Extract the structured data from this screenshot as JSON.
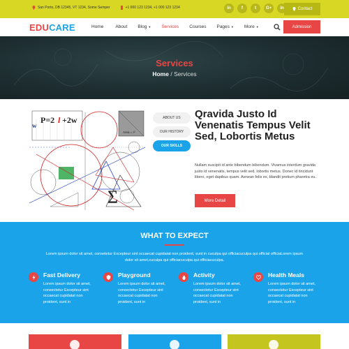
{
  "topbar": {
    "address": "San Porto, DB 12345, VT 1234, Some Semper",
    "phones": "+1 000 123 1234, +1 000 123 1234",
    "socials": [
      "in",
      "f",
      "t",
      "G+",
      "in"
    ],
    "contact_label": "Contact"
  },
  "nav": {
    "logo_edu": "EDU",
    "logo_care": "CARE",
    "items": [
      {
        "label": "Home",
        "dropdown": false
      },
      {
        "label": "About",
        "dropdown": false
      },
      {
        "label": "Blog",
        "dropdown": true
      },
      {
        "label": "Services",
        "dropdown": false
      },
      {
        "label": "Courses",
        "dropdown": false
      },
      {
        "label": "Pages",
        "dropdown": true
      },
      {
        "label": "More",
        "dropdown": true
      }
    ],
    "admission_label": "Admission"
  },
  "hero": {
    "title": "Services",
    "breadcrumb_home": "Home",
    "breadcrumb_sep": " / ",
    "breadcrumb_current": "Services"
  },
  "content": {
    "tabs": [
      "ABOUT US",
      "OUR HISTORY",
      "OUR SKILLS"
    ],
    "heading": "Qravida Justo Id Venenatis Tempus Velit Sed, Lobortis Metus",
    "text": "Nullam suscipit id ante bibendum bibendum. Vivamus interdum gravida justo id venenatis, tempus velit sed, lobortis metus. Donec id tincidunt libero, eget dapibus quam. Aenean felis ex, blandit pretium pharetra eu.",
    "button_label": "More Detail",
    "formula_1": "P=2",
    "formula_l": "l",
    "formula_2": "+2w",
    "formula_w": "w",
    "formula_sigma": "Σ",
    "formula_area": "Area = r²"
  },
  "expect": {
    "title": "WHAT TO EXPECT",
    "description": "Lorem ipsum dolor sit amet, consetetur Excepteur sint occaecat cupidatat non proident, sunt in cuculpa qui officiacuculpa qui officiaI officiaLorem ipsum dolor sit amet,cuculpa qui officiacuculpa qui officiacuculpa.",
    "features": [
      {
        "title": "Fast Delivery",
        "text": "Lorem ipsum dolor sit amet, consectetur Excepteur sint occaecat cupidatat non proident, sunt in",
        "icon": "bolt-icon"
      },
      {
        "title": "Playground",
        "text": "Lorem ipsum dolor sit amet, consectetur Excepteur sint occaecat cupidatat non proident, sunt in",
        "icon": "shield-icon"
      },
      {
        "title": "Activity",
        "text": "Lorem ipsum dolor sit amet, consectetur Excepteur sint occaecat cupidatat non proident, sunt in",
        "icon": "flame-icon"
      },
      {
        "title": "Health Meals",
        "text": "Lorem ipsum dolor sit amet, consectetur Excepteur sint occaecat cupidatat non proident, sunt in",
        "icon": "heart-icon"
      }
    ]
  },
  "bottom": {
    "cards": [
      {
        "color": "#e84545",
        "icon": "gear-icon"
      },
      {
        "color": "#1aa3e8",
        "icon": "book-icon"
      },
      {
        "color": "#c5c51f",
        "icon": "smile-icon"
      }
    ]
  },
  "colors": {
    "accent_red": "#e84545",
    "accent_blue": "#1aa3e8",
    "accent_yellow": "#d8d824"
  }
}
